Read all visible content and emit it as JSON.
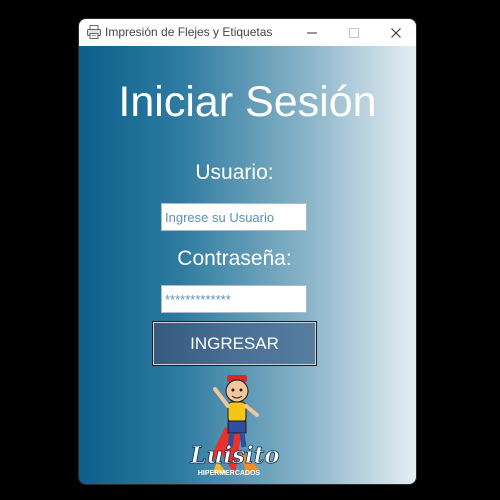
{
  "window": {
    "title": "Impresión de Flejes y Etiquetas",
    "icon": "printer-icon",
    "controls": [
      "minimize-icon",
      "maximize-icon",
      "close-icon"
    ]
  },
  "login": {
    "heading": "Iniciar Sesión",
    "user_label": "Usuario:",
    "user_placeholder": "Ingrese su Usuario",
    "password_label": "Contraseña:",
    "password_value": "*************",
    "submit_label": "INGRESAR"
  },
  "branding": {
    "logo_name": "Luisito",
    "logo_subtitle": "HIPERMERCADOS"
  },
  "colors": {
    "gradient_start": "#0c5f8c",
    "gradient_end": "#e6eef3",
    "button": "#4a7196",
    "input_text": "#5b92b5"
  }
}
